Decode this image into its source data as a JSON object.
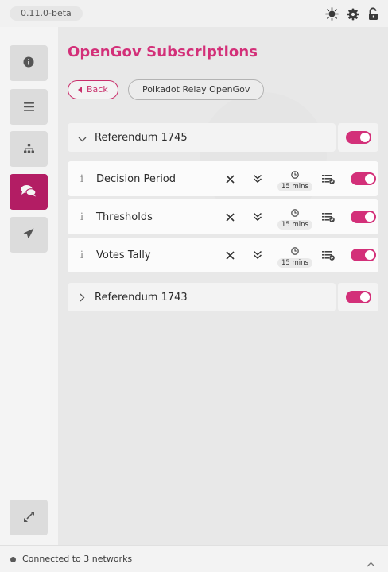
{
  "app": {
    "version": "0.11.0-beta"
  },
  "topbar": {
    "icons": [
      "sun-icon",
      "gear-icon",
      "unlock-icon"
    ]
  },
  "sidebar": {
    "items": [
      "info-icon",
      "list-icon",
      "sitemap-icon",
      "comments-icon",
      "paper-plane-icon"
    ],
    "active": "comments-icon",
    "bottom_icon": "expand-icon"
  },
  "main": {
    "title": "OpenGov Subscriptions",
    "back_label": "Back",
    "breadcrumb": "Polkadot Relay OpenGov",
    "referenda": [
      {
        "label": "Referendum 1745",
        "expanded": true,
        "enabled": true,
        "subscriptions": [
          {
            "label": "Decision Period",
            "interval": "15 mins",
            "enabled": true
          },
          {
            "label": "Thresholds",
            "interval": "15 mins",
            "enabled": true
          },
          {
            "label": "Votes Tally",
            "interval": "15 mins",
            "enabled": true
          }
        ]
      },
      {
        "label": "Referendum 1743",
        "expanded": false,
        "enabled": true
      }
    ],
    "info_glyph": "i"
  },
  "footer": {
    "status": "Connected to 3 networks"
  },
  "colors": {
    "accent": "#d33079",
    "active_nav": "#b31d64"
  }
}
